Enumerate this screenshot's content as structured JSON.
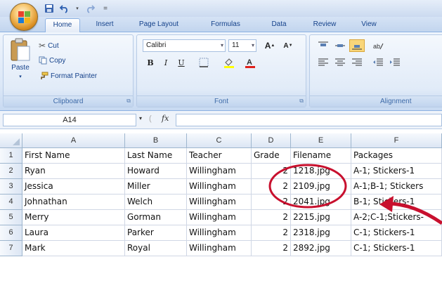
{
  "colors": {
    "accent": "#c8102e",
    "ribbon": "#dbe7f7",
    "header": "#dce6f4"
  },
  "quick_access": {
    "save_icon": "save-icon",
    "undo_icon": "undo-icon",
    "redo_icon": "redo-icon",
    "customize_glyph": "="
  },
  "tabs": [
    "Home",
    "Insert",
    "Page Layout",
    "Formulas",
    "Data",
    "Review",
    "View"
  ],
  "ribbon": {
    "clipboard": {
      "label": "Clipboard",
      "paste": "Paste",
      "cut": "Cut",
      "copy": "Copy",
      "format_painter": "Format Painter"
    },
    "font": {
      "label": "Font",
      "font_name": "Calibri",
      "font_size": "11",
      "grow": "A",
      "shrink": "A",
      "bold": "B",
      "italic": "I",
      "underline": "U"
    },
    "alignment": {
      "label": "Alignment"
    }
  },
  "formula_bar": {
    "name_box": "A14",
    "fx": "fx",
    "content": ""
  },
  "columns": [
    "A",
    "B",
    "C",
    "D",
    "E",
    "F"
  ],
  "rows": [
    {
      "num": "1",
      "cells": [
        "First Name",
        "Last Name",
        "Teacher",
        "Grade",
        "Filename",
        "Packages"
      ]
    },
    {
      "num": "2",
      "cells": [
        "Ryan",
        "Howard",
        "Willingham",
        "2",
        "1218.jpg",
        "A-1; Stickers-1"
      ]
    },
    {
      "num": "3",
      "cells": [
        "Jessica",
        "Miller",
        "Willingham",
        "2",
        "2109.jpg",
        "A-1;B-1; Stickers"
      ]
    },
    {
      "num": "4",
      "cells": [
        "Johnathan",
        "Welch",
        "Willingham",
        "2",
        "2041.jpg",
        "B-1; Stickers-1"
      ]
    },
    {
      "num": "5",
      "cells": [
        "Merry",
        "Gorman",
        "Willingham",
        "2",
        "2215.jpg",
        "A-2;C-1;Stickers-"
      ]
    },
    {
      "num": "6",
      "cells": [
        "Laura",
        "Parker",
        "Willingham",
        "2",
        "2318.jpg",
        "C-1; Stickers-1"
      ]
    },
    {
      "num": "7",
      "cells": [
        "Mark",
        "Royal",
        "Willingham",
        "2",
        "2892.jpg",
        "C-1; Stickers-1"
      ]
    }
  ]
}
